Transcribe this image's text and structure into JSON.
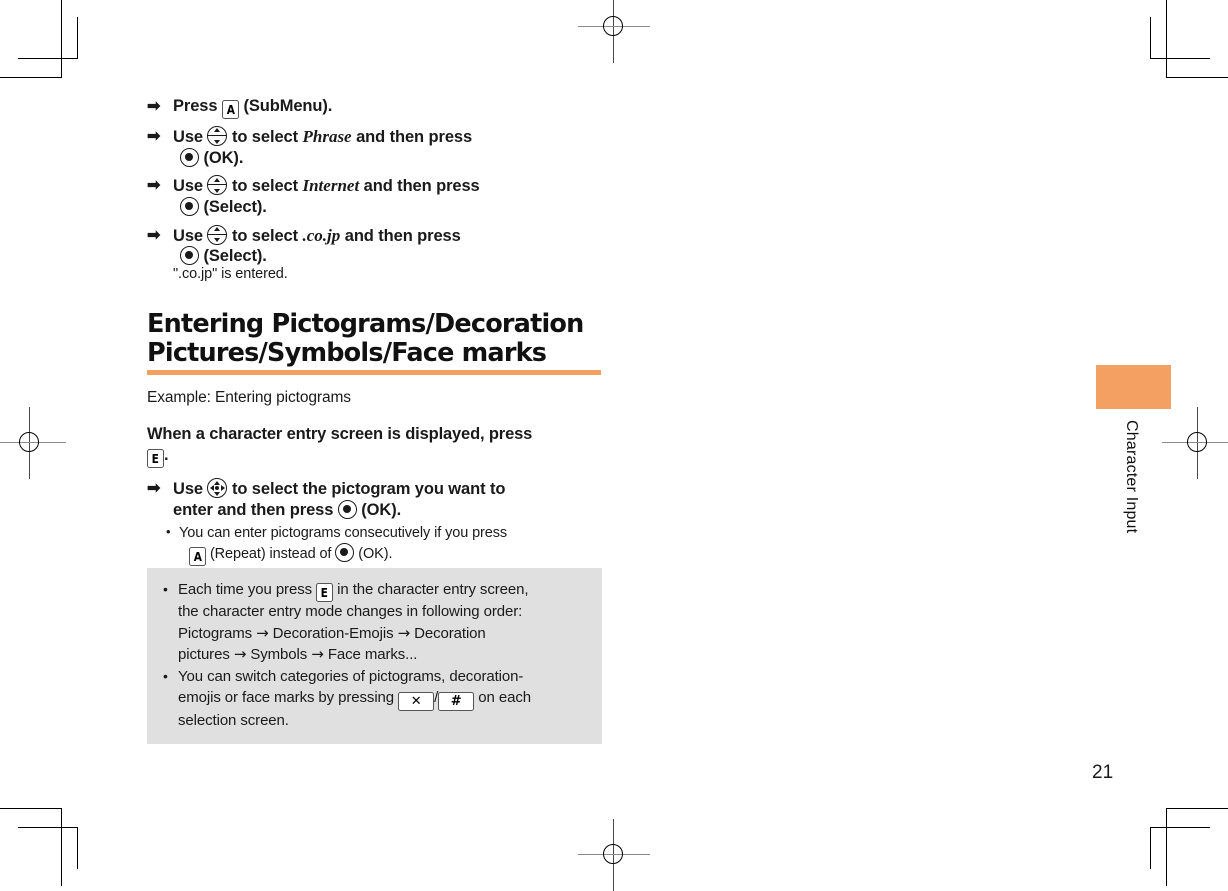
{
  "document": {
    "page_number": "21",
    "side_tab_label": "Character Input"
  },
  "steps": [
    {
      "arrow": "➡",
      "line1_a": "Press",
      "key": "A",
      "line1_b": "(SubMenu)."
    },
    {
      "arrow": "➡",
      "line1_a": "Use",
      "line1_b": "to select",
      "italic": "Phrase",
      "line1_c": "and then press",
      "line2": "(OK)."
    },
    {
      "arrow": "➡",
      "line1_a": "Use",
      "line1_b": "to select",
      "italic": "Internet",
      "line1_c": "and then press",
      "line2": "(Select)."
    },
    {
      "arrow": "➡",
      "line1_a": "Use",
      "line1_b": "to select",
      "italic": ".co.jp",
      "line1_c": "and then press",
      "line2": "(Select).",
      "note": "\".co.jp\" is entered."
    }
  ],
  "section": {
    "heading_line1": "Entering Pictograms/Decoration",
    "heading_line2": "Pictures/Symbols/Face marks",
    "accent_color": "#F4A063",
    "example": "Example: Entering pictograms",
    "intro_line1": "When a character entry screen is displayed, press",
    "intro_key": "E",
    "intro_period": ".",
    "step": {
      "arrow": "➡",
      "line1_a": "Use",
      "line1_b": "to select the pictogram you want to",
      "line2_a": "enter and then press",
      "line2_b": "(OK)."
    },
    "sub_bullet": {
      "line1": "You can enter pictograms consecutively if you press",
      "key": "A",
      "line2_a": "(Repeat) instead of",
      "line2_b": "(OK)."
    }
  },
  "note_box": {
    "background": "#e0e0e0",
    "bullets": [
      {
        "part1": "Each time you press",
        "key": "E",
        "part2": "in the character entry screen,",
        "line2": "the character entry mode changes in following order:",
        "line3_a": "Pictograms",
        "arrow1": "→",
        "line3_b": "Decoration-Emojis",
        "arrow2": "→",
        "line3_c": "Decoration",
        "line4_a": "pictures",
        "arrow3": "→",
        "line4_b": "Symbols",
        "arrow4": "→",
        "line4_c": "Face marks..."
      },
      {
        "line1": "You can switch categories of pictograms, decoration-",
        "line2_a": "emojis or face marks by pressing",
        "key_star": "✕",
        "slash": "/",
        "key_hash": "#",
        "line2_b": "on each",
        "line3": "selection screen."
      }
    ]
  },
  "icons": {
    "a_key": "a-key-icon",
    "e_key": "ez-key-icon",
    "dpad_vertical": "dpad-up-down-icon",
    "dpad_four_way": "dpad-four-way-icon",
    "center_ok": "center-ok-key-icon",
    "star_key": "star-key-icon",
    "hash_key": "hash-key-icon"
  }
}
